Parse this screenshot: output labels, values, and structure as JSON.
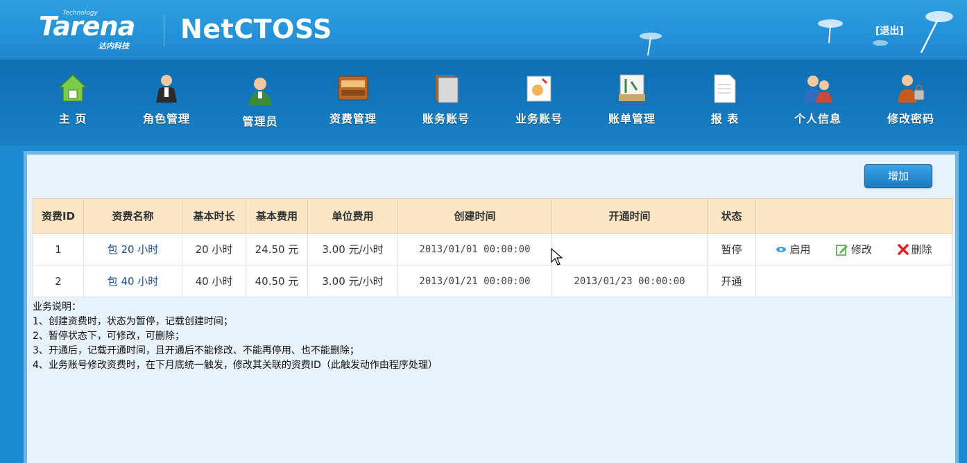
{
  "header": {
    "logo_text": "Tarena",
    "logo_tagline": "Technology",
    "logo_cn": "达内科技",
    "app_title": "NetCTOSS",
    "logout_label": "[退出]"
  },
  "nav": {
    "items": [
      {
        "label": "主 页",
        "icon": "home-icon"
      },
      {
        "label": "角色管理",
        "icon": "role-icon"
      },
      {
        "label": "管理员",
        "icon": "admin-icon"
      },
      {
        "label": "资费管理",
        "icon": "fee-icon"
      },
      {
        "label": "账务账号",
        "icon": "account-icon"
      },
      {
        "label": "业务账号",
        "icon": "service-account-icon"
      },
      {
        "label": "账单管理",
        "icon": "bill-icon"
      },
      {
        "label": "报 表",
        "icon": "report-icon"
      },
      {
        "label": "个人信息",
        "icon": "profile-icon"
      },
      {
        "label": "修改密码",
        "icon": "password-icon"
      }
    ]
  },
  "toolbar": {
    "add_label": "增加"
  },
  "table": {
    "headers": [
      "资费ID",
      "资费名称",
      "基本时长",
      "基本费用",
      "单位费用",
      "创建时间",
      "开通时间",
      "状态",
      ""
    ],
    "rows": [
      {
        "id": "1",
        "name": "包 20 小时",
        "duration": "20 小时",
        "base_fee": "24.50 元",
        "unit_fee": "3.00 元/小时",
        "created": "2013/01/01 00:00:00",
        "opened": "",
        "status": "暂停",
        "actions": {
          "enable": "启用",
          "edit": "修改",
          "delete": "删除"
        }
      },
      {
        "id": "2",
        "name": "包 40 小时",
        "duration": "40 小时",
        "base_fee": "40.50 元",
        "unit_fee": "3.00 元/小时",
        "created": "2013/01/21 00:00:00",
        "opened": "2013/01/23 00:00:00",
        "status": "开通"
      }
    ]
  },
  "notes": {
    "title": "业务说明：",
    "lines": [
      "1、创建资费时，状态为暂停，记载创建时间；",
      "2、暂停状态下，可修改，可删除；",
      "3、开通后，记载开通时间，且开通后不能修改、不能再停用、也不能删除；",
      "4、业务账号修改资费时，在下月底统一触发，修改其关联的资费ID（此触发动作由程序处理）"
    ]
  },
  "colors": {
    "header_bg": "#2592d6",
    "nav_bg": "#1376bb",
    "table_header_bg": "#fbe7c6",
    "content_bg": "#e8f2fa",
    "delete_red": "#e02020",
    "link_blue": "#1a4f9a"
  }
}
